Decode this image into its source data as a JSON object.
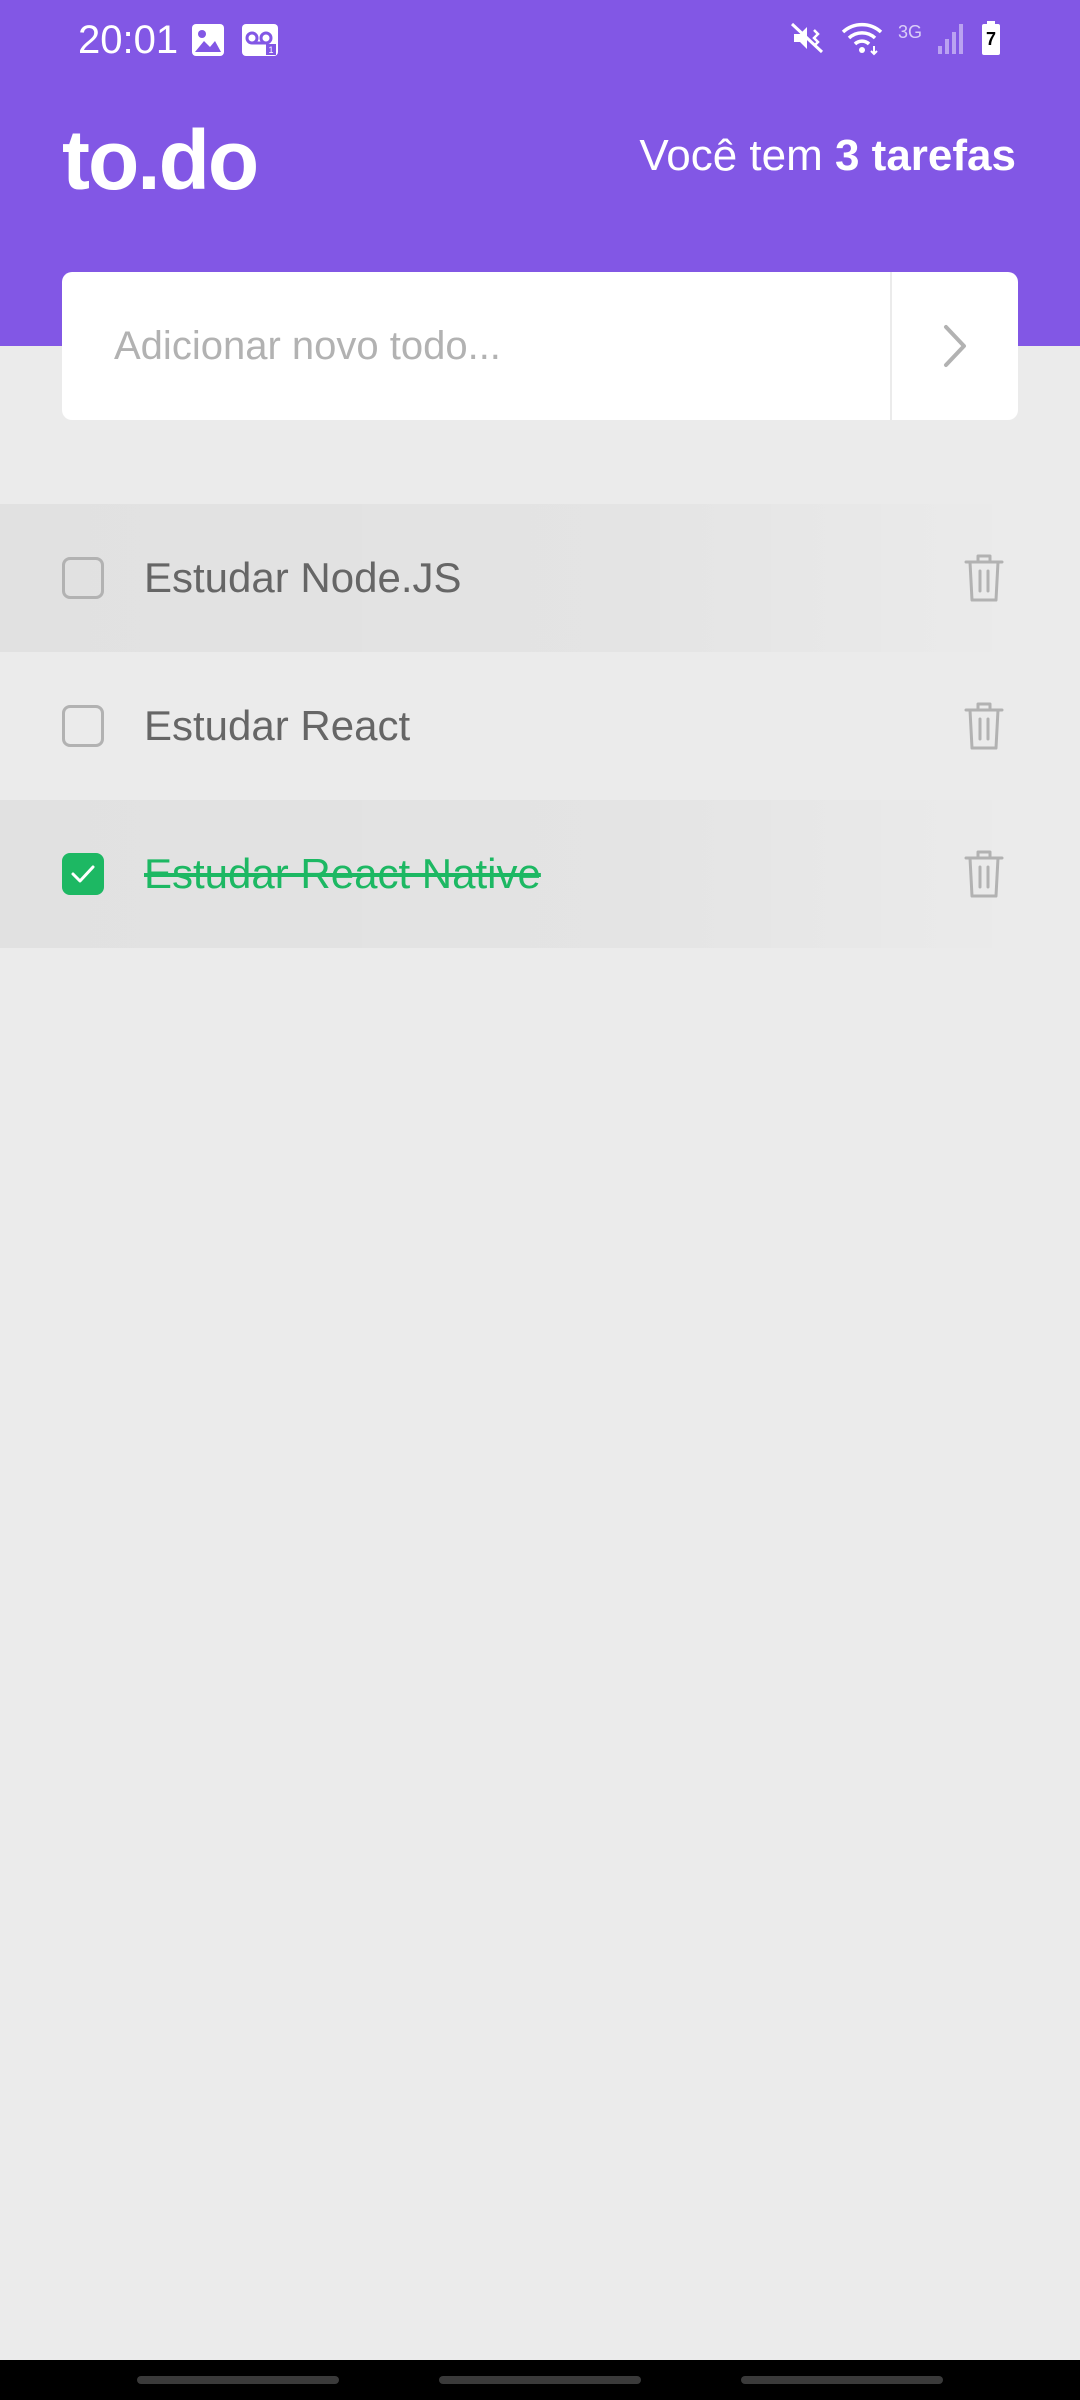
{
  "status_bar": {
    "time": "20:01",
    "network_label": "3G",
    "battery_level": "7",
    "left_icons": [
      "gallery-icon",
      "voicemail-icon"
    ],
    "right_icons": [
      "mute-vibrate-icon",
      "wifi-icon",
      "signal-icon",
      "battery-icon"
    ]
  },
  "header": {
    "logo": "to.do",
    "count_prefix": "Você tem ",
    "count_value": "3 tarefas"
  },
  "new_task_input": {
    "placeholder": "Adicionar novo todo...",
    "value": ""
  },
  "tasks": [
    {
      "title": "Estudar Node.JS",
      "done": false
    },
    {
      "title": "Estudar React",
      "done": false
    },
    {
      "title": "Estudar React Native",
      "done": true
    }
  ],
  "colors": {
    "primary": "#8257E5",
    "background": "#EBEBEB",
    "done_green": "#1DB863",
    "text_gray": "#666666",
    "icon_gray": "#B2B2B2"
  }
}
